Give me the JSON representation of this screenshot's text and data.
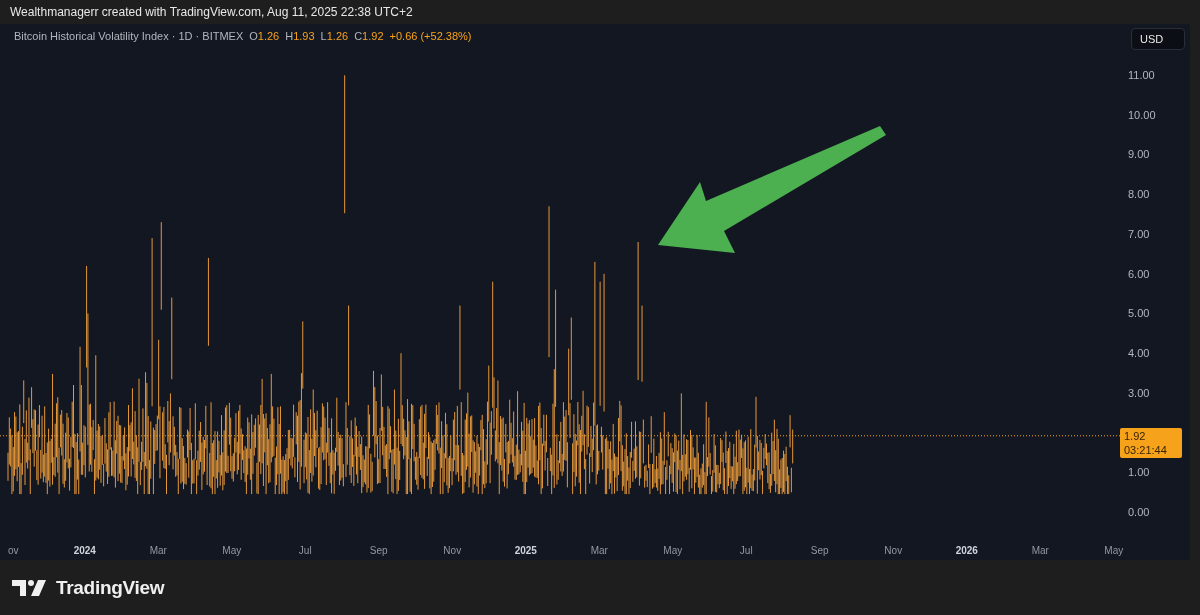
{
  "attribution": "Wealthmanagerr created with TradingView.com, Aug 11, 2025 22:38 UTC+2",
  "legend": {
    "title": "Bitcoin Historical Volatility Index · 1D · BITMEX",
    "ohlc": [
      {
        "key": "O",
        "value": "1.26"
      },
      {
        "key": "H",
        "value": "1.93"
      },
      {
        "key": "L",
        "value": "1.26"
      },
      {
        "key": "C",
        "value": "1.92"
      }
    ],
    "change": "+0.66 (+52.38%)"
  },
  "currency_button": "USD",
  "price_axis": {
    "ticks": [
      "11.00",
      "10.00",
      "9.00",
      "8.00",
      "7.00",
      "6.00",
      "5.00",
      "4.00",
      "3.00",
      "1.00",
      "0.00"
    ],
    "last_price": "1.92",
    "countdown": "03:21:44"
  },
  "time_axis": [
    {
      "label": "ov",
      "bold": false
    },
    {
      "label": "2024",
      "bold": true
    },
    {
      "label": "Mar",
      "bold": false
    },
    {
      "label": "May",
      "bold": false
    },
    {
      "label": "Jul",
      "bold": false
    },
    {
      "label": "Sep",
      "bold": false
    },
    {
      "label": "Nov",
      "bold": false
    },
    {
      "label": "2025",
      "bold": true
    },
    {
      "label": "Mar",
      "bold": false
    },
    {
      "label": "May",
      "bold": false
    },
    {
      "label": "Jul",
      "bold": false
    },
    {
      "label": "Sep",
      "bold": false
    },
    {
      "label": "Nov",
      "bold": false
    },
    {
      "label": "2026",
      "bold": true
    },
    {
      "label": "Mar",
      "bold": false
    },
    {
      "label": "May",
      "bold": false
    }
  ],
  "footer": {
    "brand": "TradingView"
  }
}
